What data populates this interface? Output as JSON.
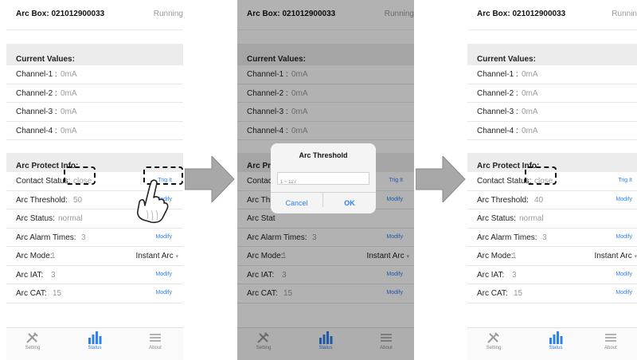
{
  "header": {
    "box_title": "Arc Box: 021012900033",
    "status": "Running",
    "status_cut": "Runnin"
  },
  "current_values": {
    "title": "Current Values:",
    "channels": [
      {
        "label": "Channel-1 :",
        "value": "0mA"
      },
      {
        "label": "Channel-2 :",
        "value": "0mA"
      },
      {
        "label": "Channel-3 :",
        "value": "0mA"
      },
      {
        "label": "Channel-4 :",
        "value": "0mA"
      }
    ]
  },
  "arc_protect": {
    "title": "Arc Protect Info:",
    "contact_status": {
      "label": "Contact Status:",
      "value": "close",
      "action": "Trig It"
    },
    "threshold": {
      "label": "Arc Threshold:",
      "value_before": "50",
      "value_after": "40",
      "action": "Modify"
    },
    "status": {
      "label": "Arc Status:",
      "value": "normal"
    },
    "alarm_times": {
      "label": "Arc Alarm Times:",
      "value": "3",
      "action": "Modify"
    },
    "mode": {
      "label": "Arc Mode:",
      "value": "1",
      "selected": "Instant Arc"
    },
    "iat": {
      "label": "Arc IAT:",
      "value": "3",
      "action": "Modify"
    },
    "cat": {
      "label": "Arc CAT:",
      "value": "15",
      "action": "Modify"
    }
  },
  "partial_labels": {
    "contact": "Contact",
    "threshold": "Arc Thre",
    "status": "Arc Stat",
    "alarm_times": "Arc Alarm Times:"
  },
  "dialog": {
    "title": "Arc Threshold",
    "placeholder": "1 ~ 127",
    "cancel": "Cancel",
    "ok": "OK"
  },
  "tabs": [
    {
      "label": "Setting"
    },
    {
      "label": "Status"
    },
    {
      "label": "About"
    }
  ],
  "colors": {
    "accent": "#2f80ed",
    "section_bg": "#ececec",
    "arrow": "#a8a8a8"
  }
}
